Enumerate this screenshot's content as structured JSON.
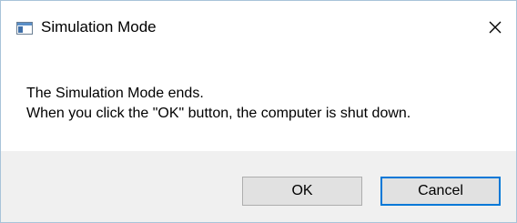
{
  "window": {
    "title": "Simulation Mode",
    "icon": "app-window-icon",
    "close_icon": "close-icon"
  },
  "message": {
    "line1": "The Simulation Mode ends.",
    "line2": "When you click the \"OK\" button, the computer is shut down."
  },
  "buttons": {
    "ok_label": "OK",
    "cancel_label": "Cancel",
    "default_button": "Cancel"
  },
  "colors": {
    "footer_bg": "#f0f0f0",
    "button_bg": "#e1e1e1",
    "focus_border": "#0078d7"
  }
}
